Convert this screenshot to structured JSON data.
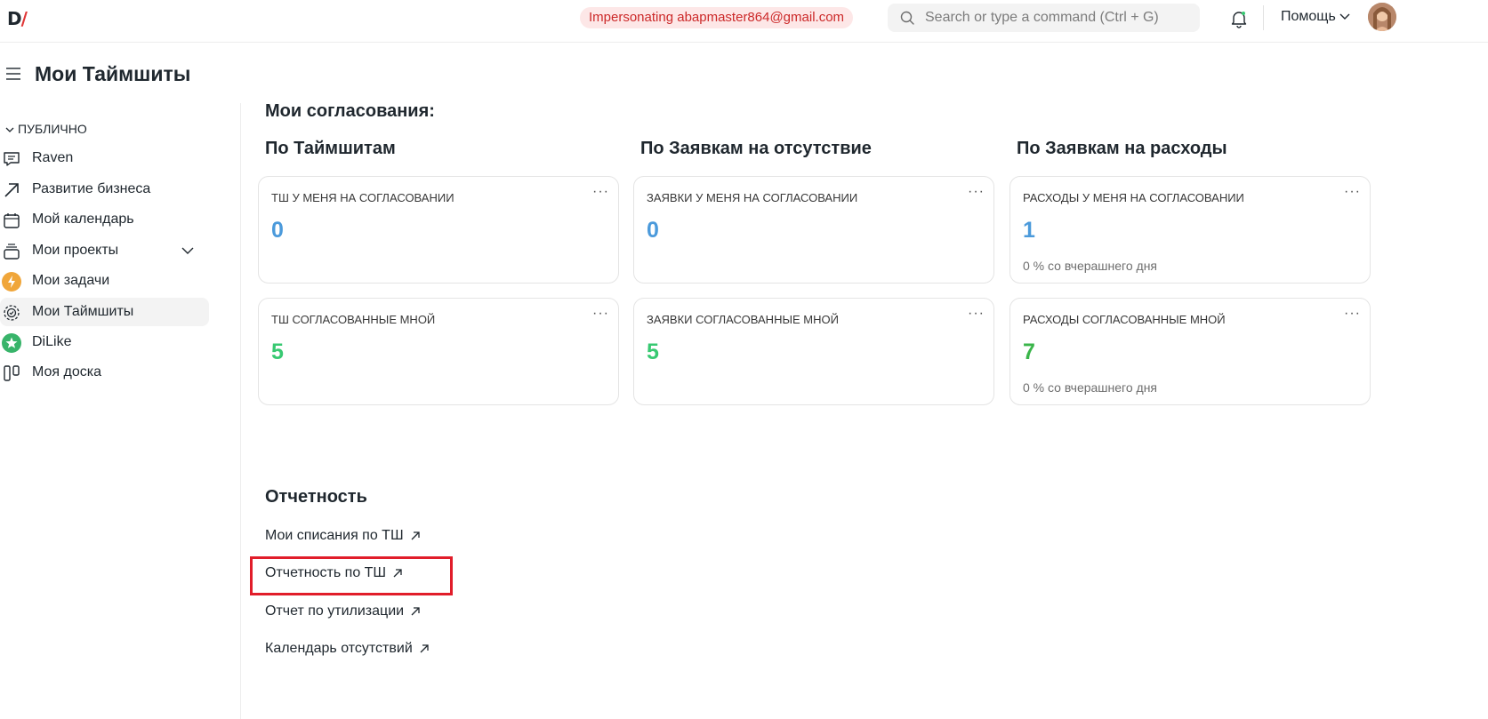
{
  "navbar": {
    "logo_letter": "D",
    "logo_slash": "/",
    "impersonating_text": "Impersonating abapmaster864@gmail.com",
    "search_placeholder": "Search or type a command (Ctrl + G)",
    "help_label": "Помощь",
    "icons": [
      "search-icon",
      "bell-icon",
      "chevron-down-icon",
      "avatar"
    ]
  },
  "page": {
    "title": "Мои Таймшиты"
  },
  "sidebar": {
    "section_label": "ПУБЛИЧНО",
    "items": [
      {
        "label": "Raven",
        "icon": "chat-icon"
      },
      {
        "label": "Развитие бизнеса",
        "icon": "arrow-up-right-icon"
      },
      {
        "label": "Мой календарь",
        "icon": "calendar-icon"
      },
      {
        "label": "Мои проекты",
        "icon": "stack-icon"
      },
      {
        "label": "Мои задачи",
        "icon": "lightning-icon"
      },
      {
        "label": "Мои Таймшиты",
        "icon": "timesheet-icon"
      },
      {
        "label": "DiLike",
        "icon": "star-icon"
      },
      {
        "label": "Моя доска",
        "icon": "board-icon"
      }
    ],
    "active_index": 5
  },
  "approvals": {
    "title": "Мои согласования:",
    "columns": [
      {
        "title": "По Таймшитам",
        "cards": [
          {
            "label": "ТШ У МЕНЯ НА СОГЛАСОВАНИИ",
            "value": "0",
            "sub": ""
          },
          {
            "label": "ТШ СОГЛАСОВАННЫЕ МНОЙ",
            "value": "5",
            "sub": ""
          }
        ]
      },
      {
        "title": "По Заявкам на отсутствие",
        "cards": [
          {
            "label": "ЗАЯВКИ У МЕНЯ НА СОГЛАСОВАНИИ",
            "value": "0",
            "sub": ""
          },
          {
            "label": "ЗАЯВКИ СОГЛАСОВАННЫЕ МНОЙ",
            "value": "5",
            "sub": ""
          }
        ]
      },
      {
        "title": "По Заявкам на расходы",
        "cards": [
          {
            "label": "РАСХОДЫ У МЕНЯ НА СОГЛАСОВАНИИ",
            "value": "1",
            "sub": "0 % со вчерашнего дня"
          },
          {
            "label": "РАСХОДЫ СОГЛАСОВАННЫЕ МНОЙ",
            "value": "7",
            "sub": "0 % со вчерашнего дня"
          }
        ]
      }
    ],
    "card_menu": "···"
  },
  "reports": {
    "title": "Отчетность",
    "links": [
      {
        "label": "Мои списания по ТШ"
      },
      {
        "label": "Отчетность по ТШ"
      },
      {
        "label": "Отчет по утилизации"
      },
      {
        "label": "Календарь отсутствий"
      }
    ]
  },
  "colors": {
    "value_blue": "#4b9adb",
    "value_green": "#38c972",
    "highlight_red": "#e11d2a",
    "impersonation_red": "#cc2929"
  }
}
